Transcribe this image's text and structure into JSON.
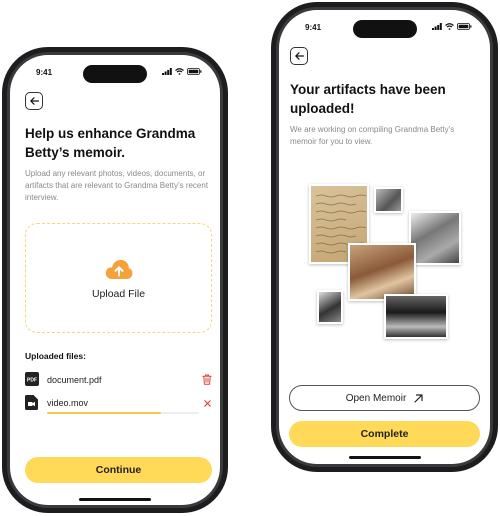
{
  "left_screen": {
    "status_time": "9:41",
    "title": "Help us enhance Grandma Betty’s memoir.",
    "subtitle": "Upload any relevant photos, videos, documents, or artifacts that are relevant to Grandma Betty’s recent interview.",
    "upload_label": "Upload File",
    "files_heading": "Uploaded files:",
    "files": [
      {
        "name": "document.pdf",
        "icon": "pdf-icon",
        "action": "trash-icon"
      },
      {
        "name": "video.mov",
        "icon": "video-file-icon",
        "action": "close-icon",
        "progress": 0.75
      }
    ],
    "continue_label": "Continue"
  },
  "right_screen": {
    "status_time": "9:41",
    "title": "Your artifacts have been uploaded!",
    "subtitle": "We are working on compiling Grandma Betty’s memoir for you to view.",
    "open_memoir_label": "Open Memoir",
    "open_memoir_icon": "arrow-up-right-icon",
    "complete_label": "Complete"
  },
  "colors": {
    "accent_yellow": "#ffd957",
    "upload_orange": "#f5a23a",
    "delete_red": "#d9453a"
  }
}
